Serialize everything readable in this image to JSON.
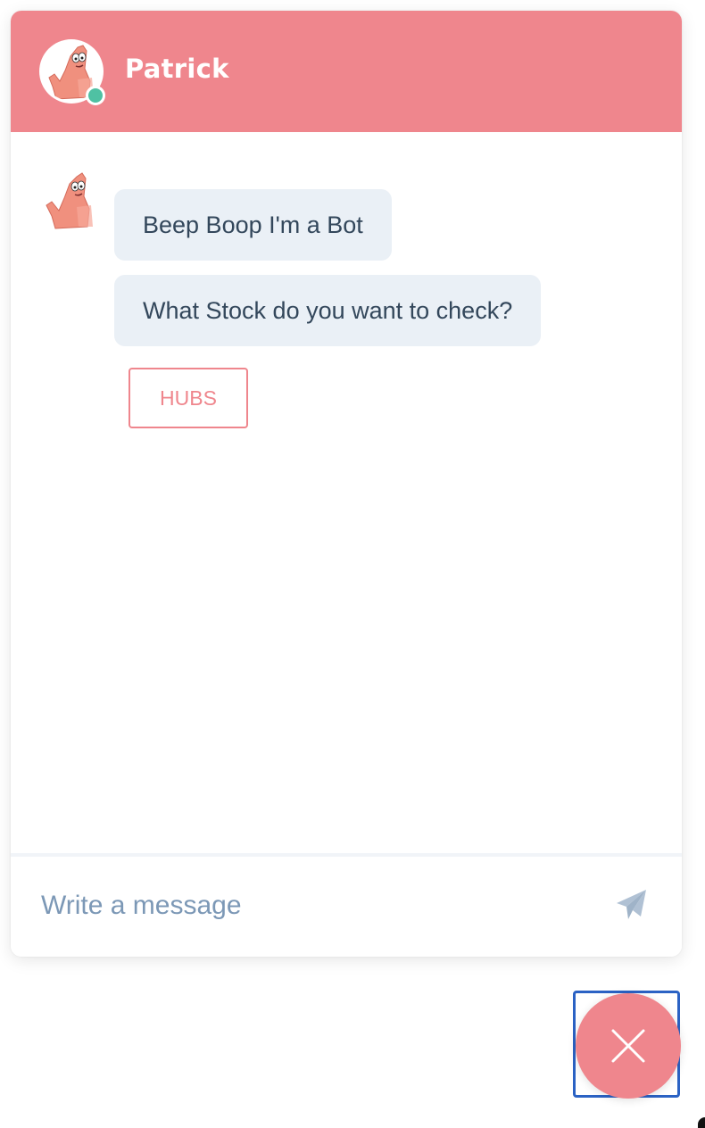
{
  "header": {
    "name": "Patrick",
    "avatar_icon": "patrick-star-avatar",
    "status": "online",
    "background_color": "#ef868d",
    "status_color": "#4fc1a3"
  },
  "messages": [
    {
      "sender": "bot",
      "text": "Beep Boop I'm a Bot"
    },
    {
      "sender": "bot",
      "text": "What Stock do you want to check?"
    }
  ],
  "quick_replies": [
    {
      "label": "HUBS"
    }
  ],
  "composer": {
    "placeholder": "Write a message",
    "send_icon": "paper-plane-icon"
  },
  "launcher": {
    "icon": "close-icon",
    "color": "#ef868d"
  }
}
